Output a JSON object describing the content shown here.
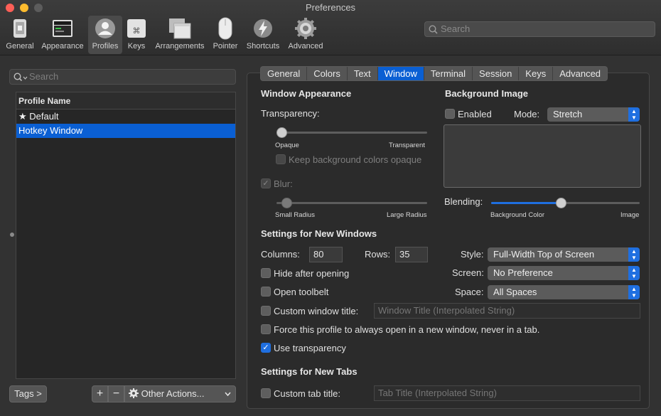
{
  "window": {
    "title": "Preferences"
  },
  "toolbar": {
    "items": [
      {
        "label": "General",
        "icon": "general-icon"
      },
      {
        "label": "Appearance",
        "icon": "appearance-icon"
      },
      {
        "label": "Profiles",
        "icon": "profiles-icon",
        "selected": true
      },
      {
        "label": "Keys",
        "icon": "keys-icon"
      },
      {
        "label": "Arrangements",
        "icon": "arrangements-icon"
      },
      {
        "label": "Pointer",
        "icon": "pointer-icon"
      },
      {
        "label": "Shortcuts",
        "icon": "shortcuts-icon"
      },
      {
        "label": "Advanced",
        "icon": "advanced-icon"
      }
    ],
    "search_placeholder": "Search"
  },
  "profiles": {
    "search_placeholder": "Search",
    "column_header": "Profile Name",
    "items": [
      {
        "name": "Default",
        "star": "★"
      },
      {
        "name": "Hotkey Window",
        "selected": true
      }
    ],
    "tags_button": "Tags >",
    "add_button": "+",
    "remove_button": "−",
    "other_actions": "Other Actions..."
  },
  "tabs": [
    "General",
    "Colors",
    "Text",
    "Window",
    "Terminal",
    "Session",
    "Keys",
    "Advanced"
  ],
  "selected_tab": "Window",
  "window_appearance": {
    "heading": "Window Appearance",
    "transparency_label": "Transparency:",
    "transparency_min": "Opaque",
    "transparency_max": "Transparent",
    "transparency_value": 0.0,
    "keep_bg_opaque": "Keep background colors opaque",
    "blur_label": "Blur:",
    "blur_checked": true,
    "blur_min": "Small Radius",
    "blur_max": "Large Radius",
    "blur_value": 0.0
  },
  "background_image": {
    "heading": "Background Image",
    "enabled_label": "Enabled",
    "enabled": false,
    "mode_label": "Mode:",
    "mode_value": "Stretch",
    "blending_label": "Blending:",
    "blending_min": "Background Color",
    "blending_max": "Image",
    "blending_value": 0.47
  },
  "new_windows": {
    "heading": "Settings for New Windows",
    "columns_label": "Columns:",
    "columns_value": "80",
    "rows_label": "Rows:",
    "rows_value": "35",
    "style_label": "Style:",
    "style_value": "Full-Width Top of Screen",
    "screen_label": "Screen:",
    "screen_value": "No Preference",
    "space_label": "Space:",
    "space_value": "All Spaces",
    "hide_after_opening": "Hide after opening",
    "open_toolbelt": "Open toolbelt",
    "custom_window_title": "Custom window title:",
    "custom_window_title_placeholder": "Window Title (Interpolated String)",
    "force_new_window": "Force this profile to always open in a new window, never in a tab.",
    "use_transparency": "Use transparency",
    "use_transparency_checked": true
  },
  "new_tabs": {
    "heading": "Settings for New Tabs",
    "custom_tab_title": "Custom tab title:",
    "custom_tab_title_placeholder": "Tab Title (Interpolated String)"
  },
  "colors": {
    "accent": "#1f6fe0",
    "selection": "#0a5fd3"
  }
}
